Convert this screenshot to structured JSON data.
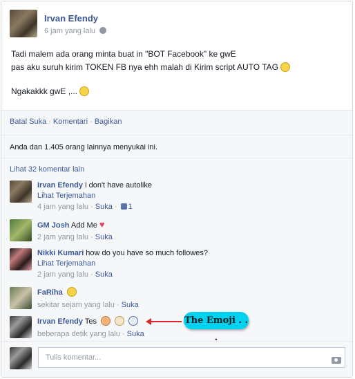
{
  "post": {
    "author": "Irvan Efendy",
    "time": "6 jam yang lalu",
    "lines": [
      "Tadi malem ada orang minta buat in \"BOT Facebook\" ke gwE",
      "pas aku suruh kirim TOKEN FB nya ehh malah di Kirim script AUTO TAG",
      "Ngakakkk gwE ,..."
    ]
  },
  "actions": {
    "unlike": "Batal Suka",
    "comment": "Komentari",
    "share": "Bagikan"
  },
  "likes_text": "Anda dan 1.405 orang lainnya menyukai ini.",
  "view_more": "Lihat 32 komentar lain",
  "comments": [
    {
      "author": "Irvan Efendy",
      "text": " i don't have autolike",
      "translate": "Lihat Terjemahan",
      "time": "4 jam yang lalu",
      "like": "Suka",
      "like_count": "1"
    },
    {
      "author": "GM Josh",
      "text": " Add Me",
      "time": "2 jam yang lalu",
      "like": "Suka"
    },
    {
      "author": "Nikki Kumari",
      "text": " how do you have so much followes?",
      "translate": "Lihat Terjemahan",
      "time": "2 jam yang lalu",
      "like": "Suka"
    },
    {
      "author": "FaRiha",
      "text": "",
      "time": "sekitar sejam yang lalu",
      "like": "Suka"
    },
    {
      "author": "Irvan Efendy",
      "text": " Tes",
      "time": "beberapa detik yang lalu",
      "like": "Suka"
    }
  ],
  "annotation": "The Emoji . . .",
  "compose": {
    "placeholder": "Tulis komentar..."
  },
  "colors": {
    "link": "#3b5998",
    "meta": "#9197a3",
    "bubble": "#00d2ef",
    "arrow": "#e0242c"
  }
}
